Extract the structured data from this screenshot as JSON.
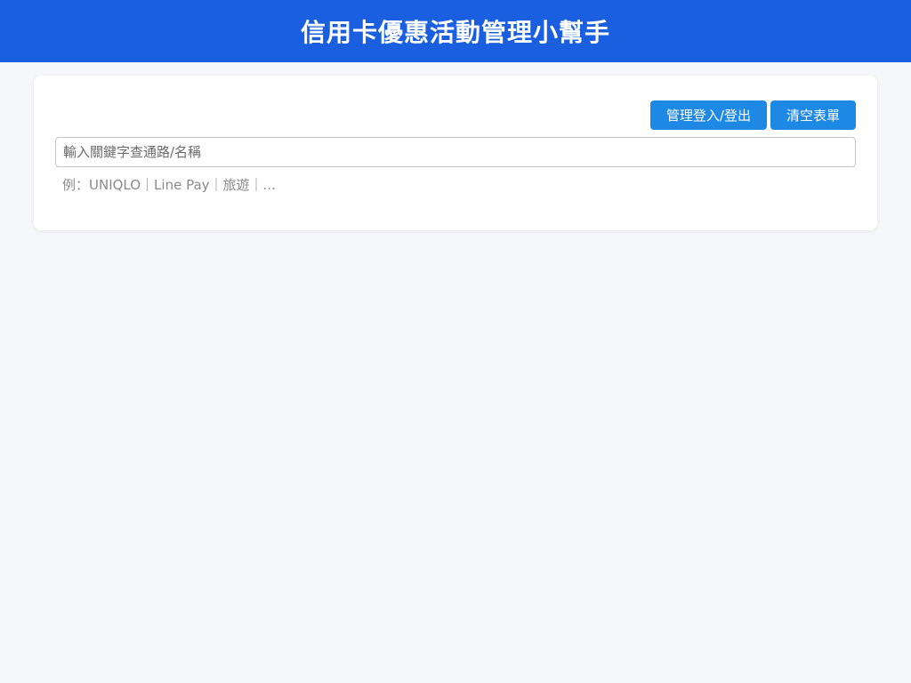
{
  "header": {
    "title": "信用卡優惠活動管理小幫手"
  },
  "toolbar": {
    "admin_label": "管理登入/登出",
    "clear_label": "清空表單"
  },
  "search": {
    "placeholder": "輸入關鍵字查通路/名稱",
    "value": "",
    "hint": "例：UNIQLO｜Line Pay｜旅遊｜..."
  },
  "colors": {
    "header_bg": "#1a5fe0",
    "button_bg": "#1e88e5",
    "page_bg": "#f5f7fa",
    "card_bg": "#ffffff"
  }
}
